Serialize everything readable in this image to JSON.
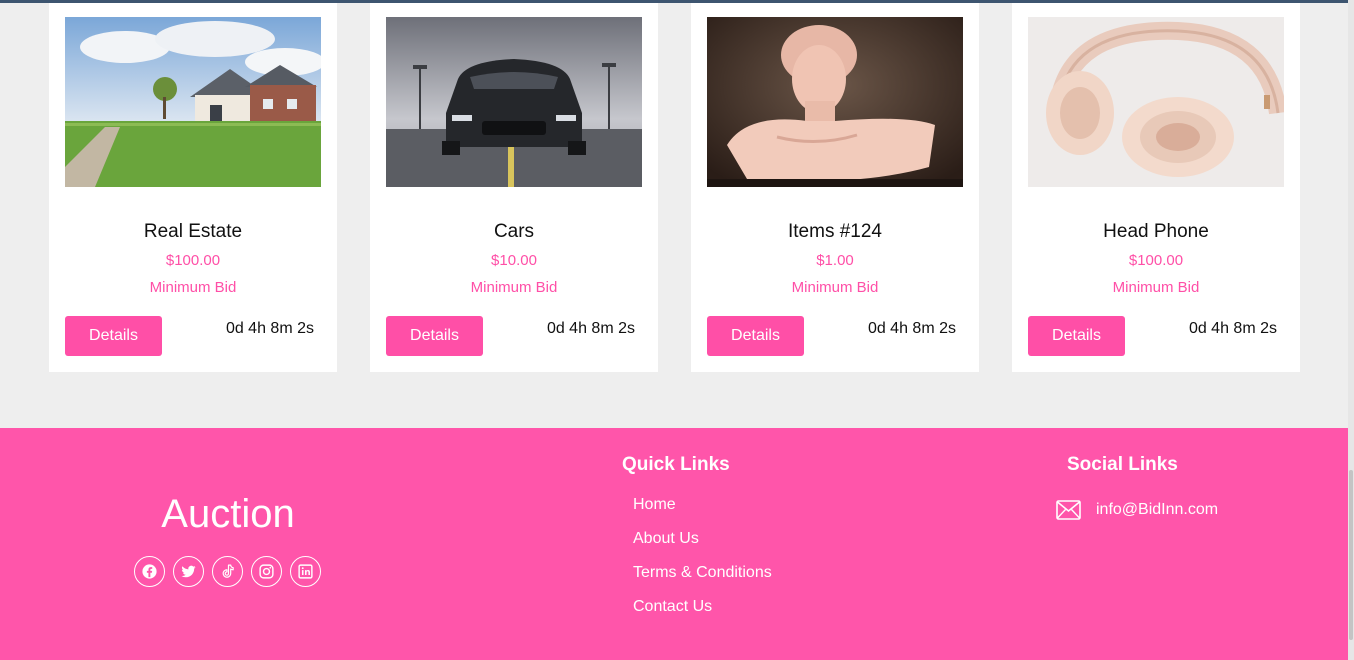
{
  "products": [
    {
      "title": "Real Estate",
      "price": "$100.00",
      "bid_label": "Minimum Bid",
      "details_label": "Details",
      "countdown": "0d 4h 8m 2s",
      "image": "house-photo"
    },
    {
      "title": "Cars",
      "price": "$10.00",
      "bid_label": "Minimum Bid",
      "details_label": "Details",
      "countdown": "0d 4h 8m 2s",
      "image": "sports-car-photo"
    },
    {
      "title": "Items #124",
      "price": "$1.00",
      "bid_label": "Minimum Bid",
      "details_label": "Details",
      "countdown": "0d 4h 8m 2s",
      "image": "marble-bust-photo"
    },
    {
      "title": "Head Phone",
      "price": "$100.00",
      "bid_label": "Minimum Bid",
      "details_label": "Details",
      "countdown": "0d 4h 8m 2s",
      "image": "headphones-photo"
    }
  ],
  "footer": {
    "brand": "Auction",
    "social_icons": [
      "facebook-icon",
      "twitter-icon",
      "tiktok-icon",
      "instagram-icon",
      "linkedin-icon"
    ],
    "quick_links": {
      "title": "Quick Links",
      "items": [
        "Home",
        "About Us",
        "Terms & Conditions",
        "Contact Us"
      ]
    },
    "social_links": {
      "title": "Social Links",
      "email": "info@BidInn.com"
    }
  },
  "colors": {
    "accent": "#ff4fa7",
    "footer_bg": "#ff55aa",
    "page_bg": "#eeeeee"
  }
}
